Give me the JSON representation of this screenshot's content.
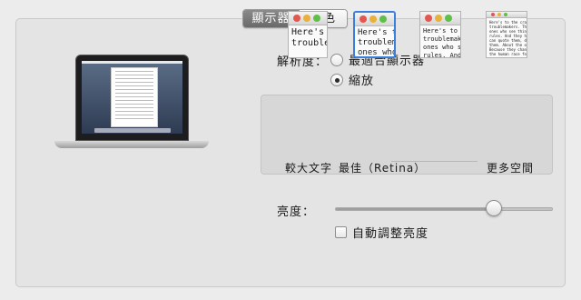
{
  "tabs": [
    {
      "label": "顯示器",
      "active": true
    },
    {
      "label": "顏色",
      "active": false
    }
  ],
  "resolution": {
    "label": "解析度：",
    "options": [
      {
        "label": "最適合顯示器",
        "checked": false
      },
      {
        "label": "縮放",
        "checked": true
      }
    ]
  },
  "scaling": {
    "presets": [
      {
        "thumb_text": "Here's to the\ntroublemak",
        "label": "較大文字",
        "selected": false
      },
      {
        "thumb_text": "Here's to th\ntroublemak\nones who s",
        "label": "最佳（Retina）",
        "selected": true
      },
      {
        "thumb_text": "Here's to the cr\ntroublemakers.\nones who see t\nrules. And they",
        "label": "",
        "selected": false
      },
      {
        "thumb_text": "Here's to the crazy one\ntroublemakers. The rou\nones who see things dif\nrules. And they have no\ncan quote them, disagre\nthem. About the only th\nBecause they change th\nthe human race forward",
        "label": "更多空間",
        "selected": false
      }
    ]
  },
  "brightness": {
    "label": "亮度：",
    "level_fraction": 0.73,
    "auto_label": "自動調整亮度",
    "auto_checked": false
  }
}
